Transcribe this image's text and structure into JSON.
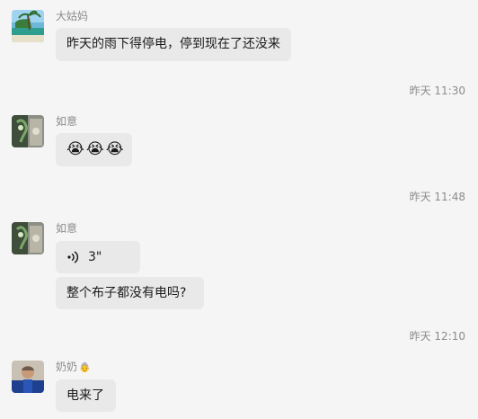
{
  "messages": [
    {
      "sender": "大姑妈",
      "text": "昨天的雨下得停电，停到现在了还没来"
    },
    {
      "timestamp": "昨天 11:30"
    },
    {
      "sender": "如意",
      "emoji": [
        "😭",
        "😭",
        "😭"
      ]
    },
    {
      "timestamp": "昨天 11:48"
    },
    {
      "sender": "如意",
      "voice_duration": "3\"",
      "text": "整个布子都没有电吗?"
    },
    {
      "timestamp": "昨天 12:10"
    },
    {
      "sender": "奶奶",
      "sender_badge": "👵",
      "text": "电来了"
    }
  ],
  "colors": {
    "background": "#f5f5f5",
    "bubble": "#e9e9e9",
    "meta_text": "#8c8c8c"
  }
}
